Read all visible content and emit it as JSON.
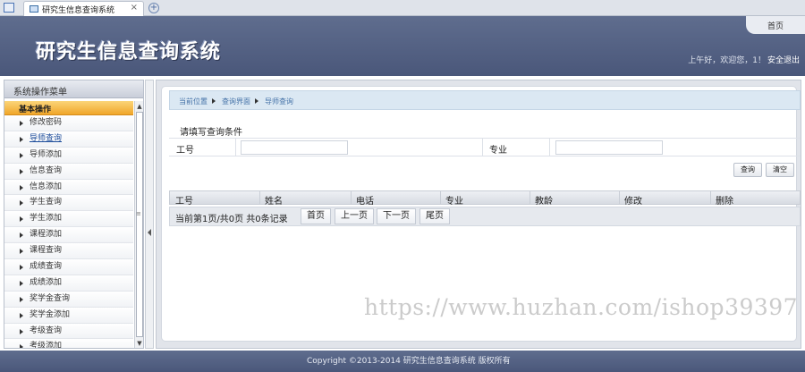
{
  "browser": {
    "tab_title": "研究生信息查询系统",
    "close_glyph": "×",
    "new_tab_glyph": "+"
  },
  "header": {
    "app_title": "研究生信息查询系统",
    "home_link": "首页",
    "greeting": "上午好，欢迎您，1！",
    "logout": "安全退出"
  },
  "sidebar": {
    "title": "系统操作菜单",
    "section": "基本操作",
    "items": [
      {
        "label": "修改密码"
      },
      {
        "label": "导师查询",
        "active": true
      },
      {
        "label": "导师添加"
      },
      {
        "label": "信息查询"
      },
      {
        "label": "信息添加"
      },
      {
        "label": "学生查询"
      },
      {
        "label": "学生添加"
      },
      {
        "label": "课程添加"
      },
      {
        "label": "课程查询"
      },
      {
        "label": "成绩查询"
      },
      {
        "label": "成绩添加"
      },
      {
        "label": "奖学金查询"
      },
      {
        "label": "奖学金添加"
      },
      {
        "label": "考级查询"
      },
      {
        "label": "考级添加"
      }
    ],
    "scroll_up": "▲",
    "scroll_down": "▼",
    "scroll_grip": "≡"
  },
  "breadcrumb": {
    "items": [
      "当前位置",
      "查询界面",
      "导师查询"
    ]
  },
  "query": {
    "title": "请填写查询条件",
    "field1_label": "工号",
    "field1_value": "",
    "field2_label": "专业",
    "field2_value": "",
    "search_button": "查询",
    "clear_button": "清空"
  },
  "table": {
    "columns": [
      "工号",
      "姓名",
      "电话",
      "专业",
      "教龄",
      "修改",
      "删除"
    ],
    "rows": []
  },
  "pager": {
    "info": "当前第1页/共0页  共0条记录",
    "first": "首页",
    "prev": "上一页",
    "next": "下一页",
    "last": "尾页"
  },
  "watermark": "https://www.huzhan.com/ishop39397",
  "footer": {
    "copyright": "Copyright ©2013-2014 研究生信息查询系统 版权所有"
  }
}
